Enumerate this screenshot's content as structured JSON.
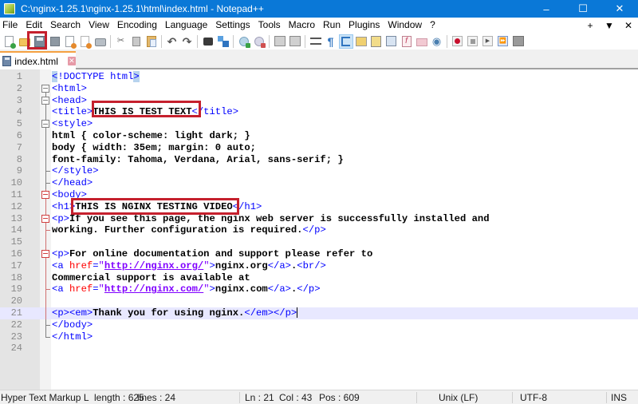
{
  "window": {
    "title": "C:\\nginx-1.25.1\\nginx-1.25.1\\html\\index.html - Notepad++",
    "controls": {
      "minimize": "–",
      "maximize": "☐",
      "close": "✕"
    }
  },
  "menu": {
    "items": [
      "File",
      "Edit",
      "Search",
      "View",
      "Encoding",
      "Language",
      "Settings",
      "Tools",
      "Macro",
      "Run",
      "Plugins",
      "Window",
      "?"
    ],
    "right": {
      "add": "+",
      "dropdown": "▼",
      "close": "✕"
    }
  },
  "toolbar": {
    "icons": [
      "new-file-icon",
      "open-file-icon",
      "save-icon",
      "save-all-icon",
      "close-icon",
      "close-all-icon",
      "print-icon",
      "cut-icon",
      "copy-icon",
      "paste-icon",
      "undo-icon",
      "redo-icon",
      "find-icon",
      "replace-icon",
      "zoom-in-icon",
      "zoom-out-icon",
      "sync-vertical-icon",
      "sync-horizontal-icon",
      "word-wrap-icon",
      "show-all-characters-icon",
      "indent-guide-icon",
      "udl-icon",
      "doc-map-icon",
      "doc-list-icon",
      "function-list-icon",
      "folder-as-workspace-icon",
      "monitoring-icon",
      "record-macro-icon",
      "stop-recording-icon",
      "playback-macro-icon",
      "run-macro-multiple-icon",
      "save-macro-icon"
    ],
    "glyphs": {
      "cut": "✂",
      "undo": "↶",
      "redo": "↷",
      "find": "🔍",
      "pilcrow": "¶",
      "eye": "◉",
      "play": "▶",
      "ff": "⏩"
    }
  },
  "tabs": [
    {
      "label": "index.html",
      "close": "✕",
      "active": true
    }
  ],
  "editor": {
    "current_line": 21,
    "lines": [
      {
        "n": "1",
        "text": "<!DOCTYPE html>"
      },
      {
        "n": "2",
        "text": "<html>"
      },
      {
        "n": "3",
        "text": "<head>"
      },
      {
        "n": "4",
        "text": "<title>THIS IS TEST TEXT</title>"
      },
      {
        "n": "5",
        "text": "<style>"
      },
      {
        "n": "6",
        "text": "html { color-scheme: light dark; }"
      },
      {
        "n": "7",
        "text": "body { width: 35em; margin: 0 auto;"
      },
      {
        "n": "8",
        "text": "font-family: Tahoma, Verdana, Arial, sans-serif; }"
      },
      {
        "n": "9",
        "text": "</style>"
      },
      {
        "n": "10",
        "text": "</head>"
      },
      {
        "n": "11",
        "text": "<body>"
      },
      {
        "n": "12",
        "text": "<h1>THIS IS NGINX TESTING VIDEO</h1>"
      },
      {
        "n": "13",
        "text": "<p>If you see this page, the nginx web server is successfully installed and"
      },
      {
        "n": "14",
        "text": "working. Further configuration is required.</p>"
      },
      {
        "n": "15",
        "text": ""
      },
      {
        "n": "16",
        "text": "<p>For online documentation and support please refer to"
      },
      {
        "n": "17",
        "text": "<a href=\"http://nginx.org/\">nginx.org</a>.<br/>"
      },
      {
        "n": "18",
        "text": "Commercial support is available at"
      },
      {
        "n": "19",
        "text": "<a href=\"http://nginx.com/\">nginx.com</a>.</p>"
      },
      {
        "n": "20",
        "text": ""
      },
      {
        "n": "21",
        "text": "<p><em>Thank you for using nginx.</em></p>"
      },
      {
        "n": "22",
        "text": "</body>"
      },
      {
        "n": "23",
        "text": "</html>"
      },
      {
        "n": "24",
        "text": ""
      }
    ],
    "highlighted_text": [
      "THIS IS TEST TEXT",
      "THIS IS NGINX TESTING VIDEO"
    ]
  },
  "status": {
    "language": "Hyper Text Markup L",
    "length": "length : 625",
    "lines": "lines : 24",
    "ln": "Ln : 21",
    "col": "Col : 43",
    "pos": "Pos : 609",
    "eol": "Unix (LF)",
    "encoding": "UTF-8",
    "mode": "INS"
  },
  "colors": {
    "titlebar": "#0a78d7",
    "highlight_box": "#c5202d",
    "tag": "#0000ff",
    "attribute": "#ff0000",
    "string": "#8000ff",
    "current_line": "#e8e8ff"
  }
}
